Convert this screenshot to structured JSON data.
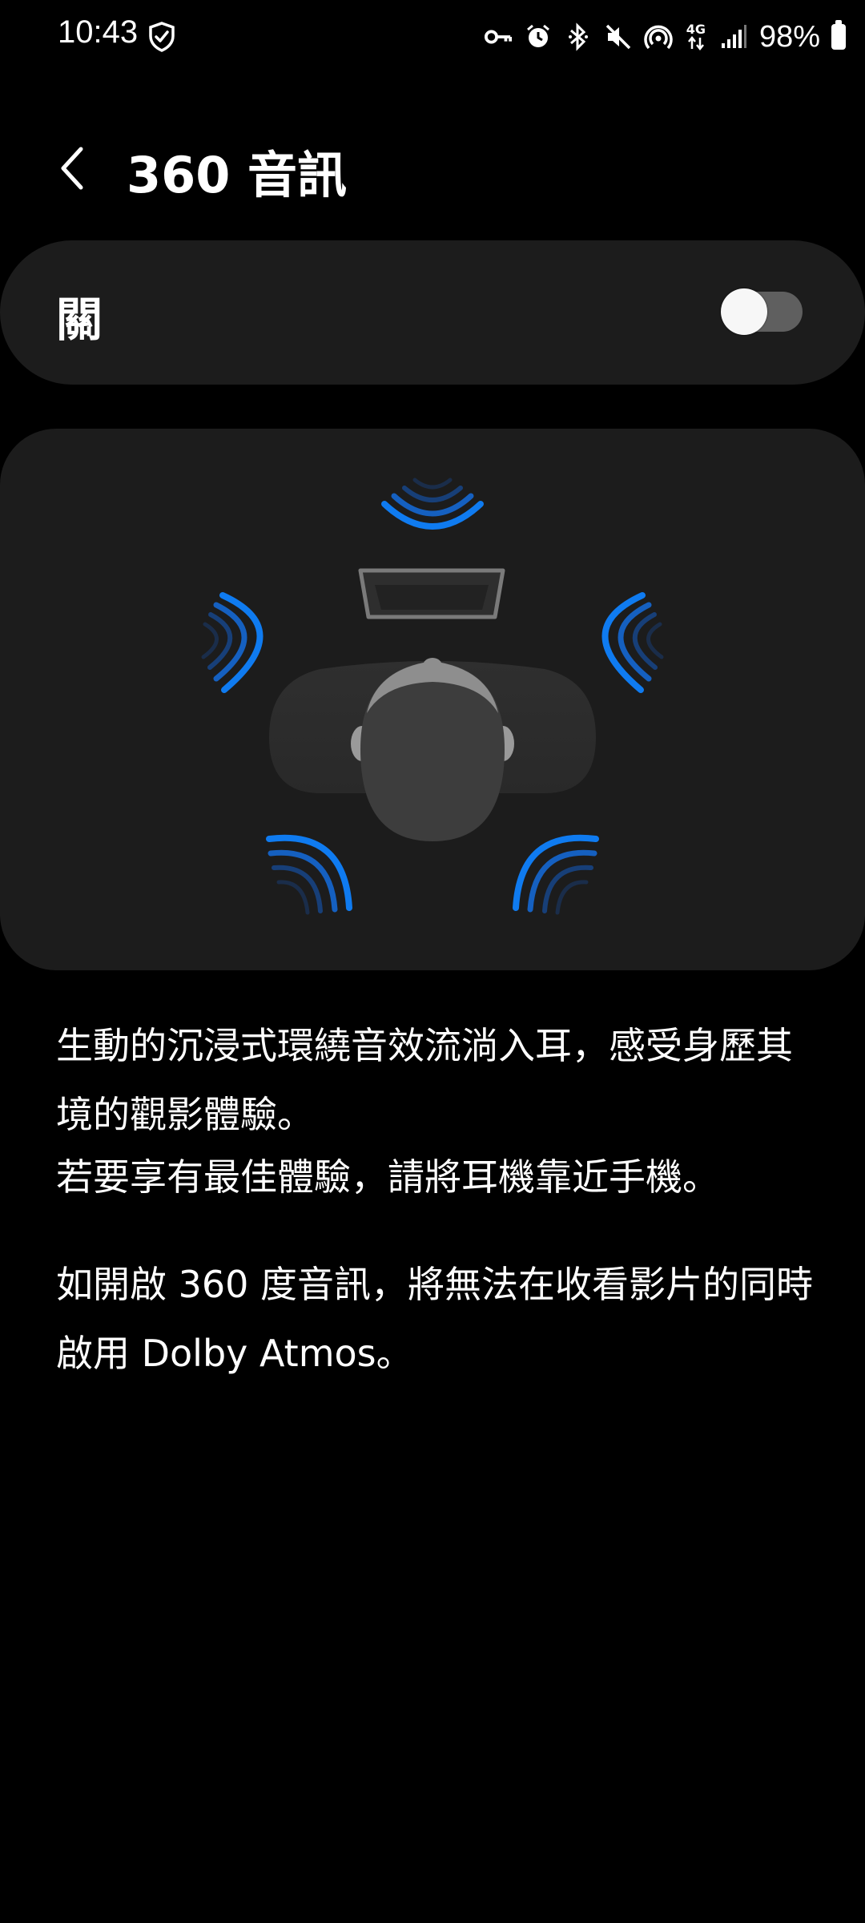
{
  "status_bar": {
    "time": "10:43",
    "battery_percent": "98%",
    "network_label": "4G",
    "icons": [
      "shield-icon",
      "key-icon",
      "alarm-icon",
      "bluetooth-icon",
      "mute-icon",
      "hotspot-icon",
      "data-arrows-icon",
      "signal-icon",
      "battery-icon"
    ]
  },
  "header": {
    "title": "360 音訊",
    "back_icon": "chevron-left-icon"
  },
  "toggle": {
    "label": "關",
    "state": "off"
  },
  "illustration": {
    "icon": "spatial-audio-illustration",
    "accent_color": "#1a73e8"
  },
  "description": {
    "line1": "生動的沉浸式環繞音效流淌入耳，感受身歷其境的觀影體驗。",
    "line2": "若要享有最佳體驗，請將耳機靠近手機。",
    "note": "如開啟 360 度音訊，將無法在收看影片的同時啟用 Dolby Atmos。"
  }
}
